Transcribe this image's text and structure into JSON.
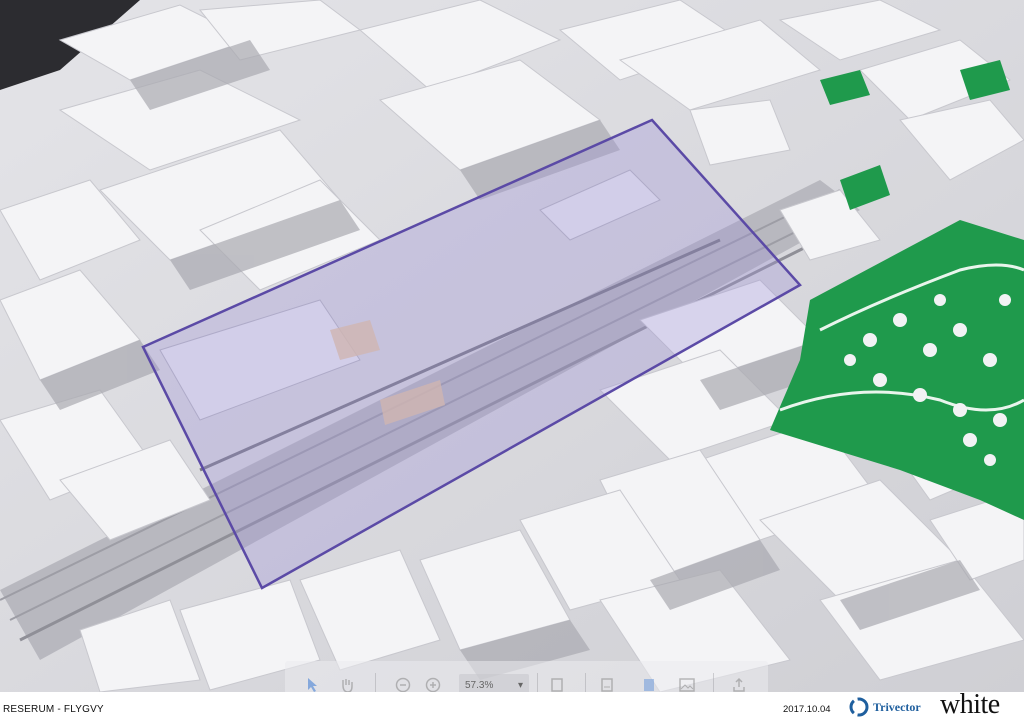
{
  "viewer": {
    "caption": "RESERUM - FLYGVY",
    "date": "2017.10.04",
    "zoom_value": "57.3%"
  },
  "logos": {
    "trivector": "Trivector",
    "white": "white"
  },
  "toolbar": {
    "icons": [
      "cursor-icon",
      "hand-icon",
      "zoom-out-icon",
      "zoom-in-icon",
      "page-icon",
      "save-icon",
      "bookmark-icon",
      "image-icon",
      "share-icon"
    ]
  },
  "colors": {
    "highlight_border": "#5b4aa6",
    "highlight_fill": "#9a8fd6",
    "park_green": "#1f9a4c",
    "trivector_blue": "#1f5f9e"
  }
}
